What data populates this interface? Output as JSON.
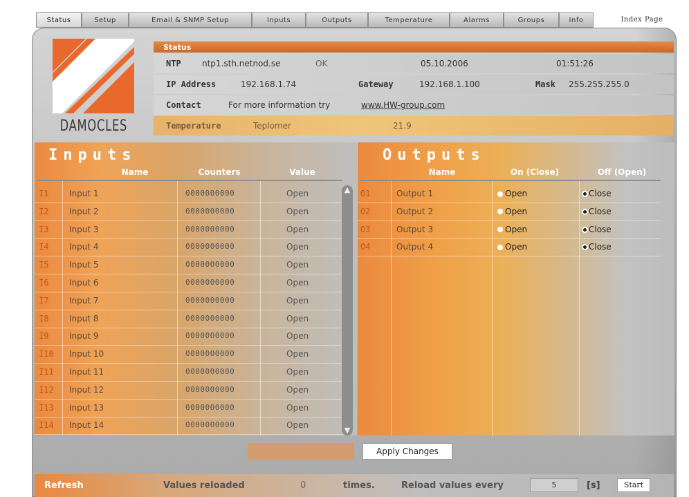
{
  "tabs": [
    {
      "label": "Status",
      "active": true
    },
    {
      "label": "Setup"
    },
    {
      "label": "Email & SNMP Setup"
    },
    {
      "label": "Inputs"
    },
    {
      "label": "Outputs"
    },
    {
      "label": "Temperature"
    },
    {
      "label": "Alarms"
    },
    {
      "label": "Groups"
    },
    {
      "label": "Info"
    }
  ],
  "index_link": "Index Page",
  "logo_text": "DAMOCLES",
  "status": {
    "header": "Status",
    "ntp_label": "NTP",
    "ntp_server": "ntp1.sth.netnod.se",
    "ntp_state": "OK",
    "date": "05.10.2006",
    "time": "01:51:26",
    "ip_label": "IP Address",
    "ip": "192.168.1.74",
    "gateway_label": "Gateway",
    "gateway": "192.168.1.100",
    "mask_label": "Mask",
    "mask": "255.255.255.0",
    "contact_label": "Contact",
    "contact_text": "For more information try",
    "contact_link": "www.HW-group.com",
    "temp_label": "Temperature",
    "temp_name": "Teplomer",
    "temp_value": "21.9"
  },
  "inputs": {
    "title": "Inputs",
    "col_name": "Name",
    "col_counters": "Counters",
    "col_value": "Value",
    "rows": [
      {
        "id": "I1",
        "name": "Input 1",
        "counter": "0000000000",
        "value": "Open"
      },
      {
        "id": "I2",
        "name": "Input 2",
        "counter": "0000000000",
        "value": "Open"
      },
      {
        "id": "I3",
        "name": "Input 3",
        "counter": "0000000000",
        "value": "Open"
      },
      {
        "id": "I4",
        "name": "Input 4",
        "counter": "0000000000",
        "value": "Open"
      },
      {
        "id": "I5",
        "name": "Input 5",
        "counter": "0000000000",
        "value": "Open"
      },
      {
        "id": "I6",
        "name": "Input 6",
        "counter": "0000000000",
        "value": "Open"
      },
      {
        "id": "I7",
        "name": "Input 7",
        "counter": "0000000000",
        "value": "Open"
      },
      {
        "id": "I8",
        "name": "Input 8",
        "counter": "0000000000",
        "value": "Open"
      },
      {
        "id": "I9",
        "name": "Input 9",
        "counter": "0000000000",
        "value": "Open"
      },
      {
        "id": "I10",
        "name": "Input 10",
        "counter": "0000000000",
        "value": "Open"
      },
      {
        "id": "I11",
        "name": "Input 11",
        "counter": "0000000000",
        "value": "Open"
      },
      {
        "id": "I12",
        "name": "Input 12",
        "counter": "0000000000",
        "value": "Open"
      },
      {
        "id": "I13",
        "name": "Input 13",
        "counter": "0000000000",
        "value": "Open"
      },
      {
        "id": "I14",
        "name": "Input 14",
        "counter": "0000000000",
        "value": "Open"
      }
    ]
  },
  "outputs": {
    "title": "Outputs",
    "col_name": "Name",
    "col_on": "On (Close)",
    "col_off": "Off (Open)",
    "rows": [
      {
        "id": "O1",
        "name": "Output 1",
        "on_label": "Open",
        "off_label": "Close",
        "selected": "off"
      },
      {
        "id": "O2",
        "name": "Output 2",
        "on_label": "Open",
        "off_label": "Close",
        "selected": "off"
      },
      {
        "id": "O3",
        "name": "Output 3",
        "on_label": "Open",
        "off_label": "Close",
        "selected": "off"
      },
      {
        "id": "O4",
        "name": "Output 4",
        "on_label": "Open",
        "off_label": "Close",
        "selected": "off"
      }
    ]
  },
  "apply_label": "Apply Changes",
  "bottom": {
    "refresh": "Refresh",
    "reloaded_label": "Values reloaded",
    "reloaded_count": "0",
    "times": "times.",
    "reload_every": "Reload values every",
    "interval": "5",
    "unit": "[s]",
    "start": "Start"
  },
  "colors": {
    "accent": "#e8893f",
    "panel_gray": "#bdbdbd"
  }
}
